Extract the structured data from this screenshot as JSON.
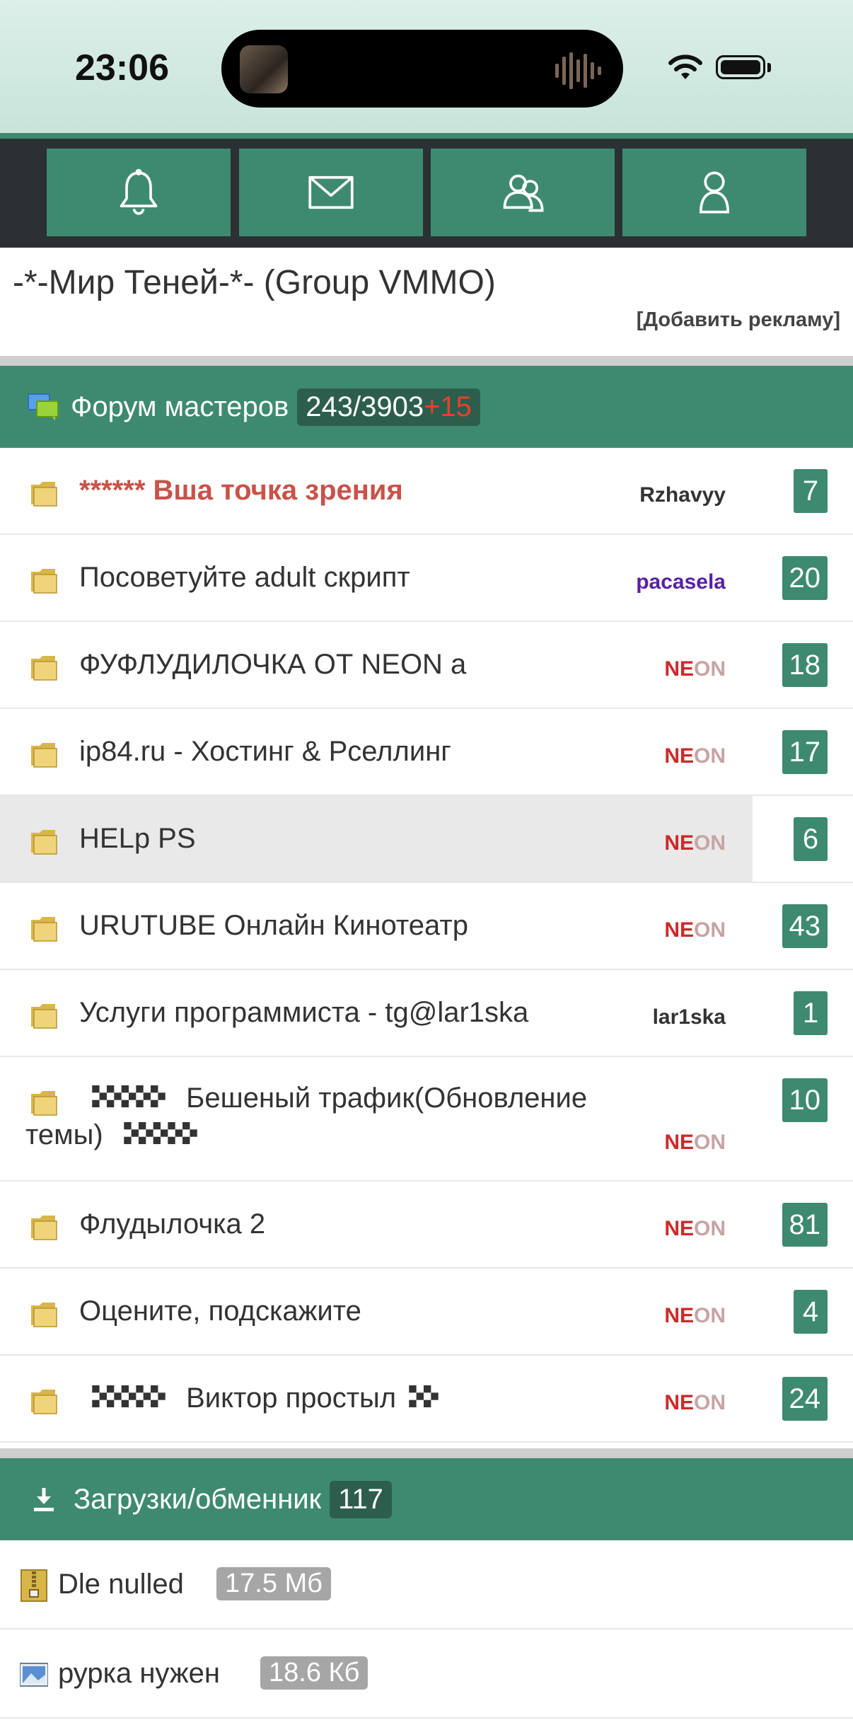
{
  "status_bar": {
    "time": "23:06"
  },
  "nav": {
    "items": [
      {
        "icon": "bell-icon"
      },
      {
        "icon": "mail-icon"
      },
      {
        "icon": "users-icon"
      },
      {
        "icon": "user-icon"
      }
    ]
  },
  "page": {
    "title": "-*-Мир Теней-*- (Group VMMO)",
    "add_ad_link": "[Добавить рекламу]"
  },
  "forum": {
    "title": "Форум мастеров",
    "count": "243/3903",
    "new_count": "+15",
    "topics": [
      {
        "title": "****** Вша точка зрения",
        "author": "Rzhavyy",
        "replies": "7"
      },
      {
        "title": "Посоветуйте adult скрипт",
        "author": "pacasela",
        "replies": "20"
      },
      {
        "title": "ФУФЛУДИЛОЧКА ОТ NEON а",
        "author_a": "NE",
        "author_b": "ON",
        "replies": "18"
      },
      {
        "title": "ip84.ru - Хостинг & Рселлинг",
        "author_a": "NE",
        "author_b": "ON",
        "replies": "17"
      },
      {
        "title": "HELp PS",
        "author_a": "NE",
        "author_b": "ON",
        "replies": "6"
      },
      {
        "title": "URUTUBE Онлайн Кинотеатр",
        "author_a": "NE",
        "author_b": "ON",
        "replies": "43"
      },
      {
        "title": "Услуги программиста - tg@lar1ska",
        "author": "lar1ska",
        "replies": "1"
      },
      {
        "title_a": "Бешеный трафик(Обновление",
        "title_b": "темы)",
        "author_a": "NE",
        "author_b": "ON",
        "replies": "10"
      },
      {
        "title": "Флудылочка 2",
        "author_a": "NE",
        "author_b": "ON",
        "replies": "81"
      },
      {
        "title": "Оцените, подскажите",
        "author_a": "NE",
        "author_b": "ON",
        "replies": "4"
      },
      {
        "title": "Виктор простыл",
        "author_a": "NE",
        "author_b": "ON",
        "replies": "24"
      }
    ]
  },
  "downloads": {
    "title": "Загрузки/обменник",
    "count": "117",
    "files": [
      {
        "name": "Dle nulled",
        "size": "17.5 Мб",
        "icon": "archive-icon"
      },
      {
        "name": "рурка нужен",
        "size": "18.6 Кб",
        "icon": "image-file-icon"
      }
    ]
  },
  "colors": {
    "accent": "#3e8a70",
    "dark_bar": "#2b3033",
    "new_count": "#e8412c",
    "hot_topic": "#c9524a"
  }
}
